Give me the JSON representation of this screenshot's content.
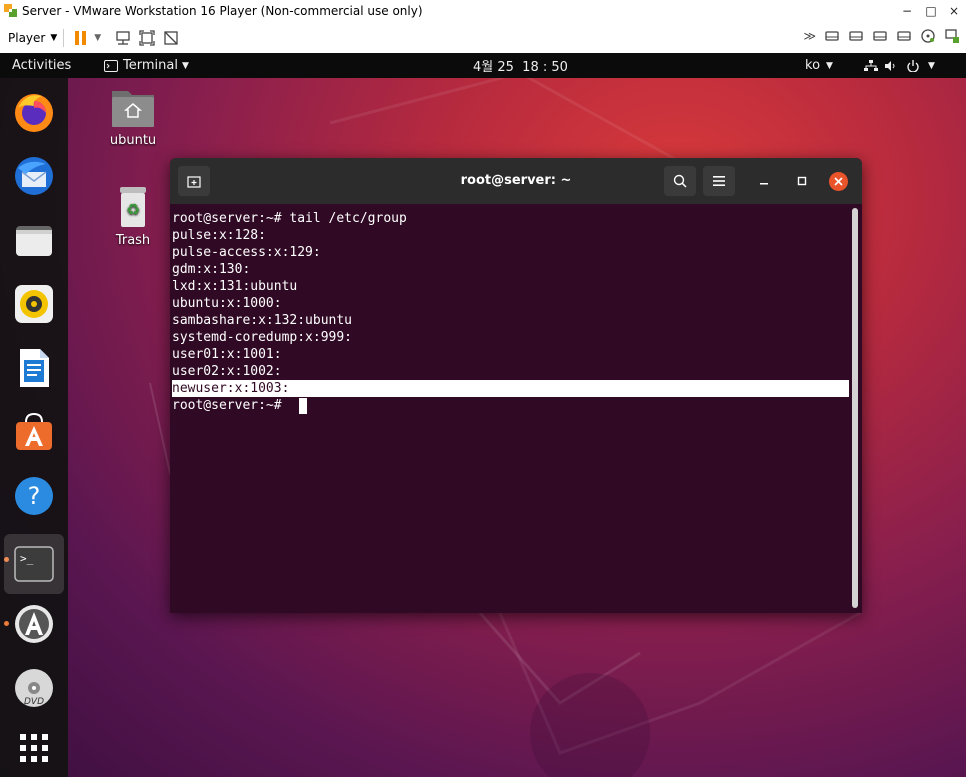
{
  "vmware": {
    "title": "Server - VMware Workstation 16 Player (Non-commercial use only)",
    "minimize": "−",
    "maximize": "□",
    "close": "×",
    "player_menu": "Player",
    "pause_icon": "pause-icon",
    "accent": "#f6a623"
  },
  "topbar": {
    "activities": "Activities",
    "terminal_menu": "Terminal",
    "datetime": "4월 25  18 : 50",
    "keyboard_layout": "ko"
  },
  "desktop": {
    "icons": [
      {
        "label": "ubuntu",
        "icon": "home-folder-icon"
      },
      {
        "label": "Trash",
        "icon": "trash-icon"
      }
    ]
  },
  "dock": {
    "apps": [
      {
        "icon": "firefox-icon"
      },
      {
        "icon": "thunderbird-icon"
      },
      {
        "icon": "files-icon"
      },
      {
        "icon": "rhythmbox-icon"
      },
      {
        "icon": "libreoffice-writer-icon"
      },
      {
        "icon": "ubuntu-software-icon"
      },
      {
        "icon": "help-icon"
      },
      {
        "icon": "terminal-icon"
      },
      {
        "icon": "software-updater-icon"
      },
      {
        "icon": "dvd-icon"
      },
      {
        "icon": "show-applications-icon"
      }
    ]
  },
  "terminal": {
    "title": "root@server: ~",
    "lines": [
      "root@server:~# tail /etc/group",
      "pulse:x:128:",
      "pulse-access:x:129:",
      "gdm:x:130:",
      "lxd:x:131:ubuntu",
      "ubuntu:x:1000:",
      "sambashare:x:132:ubuntu",
      "systemd-coredump:x:999:",
      "user01:x:1001:",
      "user02:x:1002:",
      "newuser:x:1003:",
      "root@server:~# "
    ],
    "highlighted_line": "newuser:x:1003:",
    "background": "#300a24"
  }
}
